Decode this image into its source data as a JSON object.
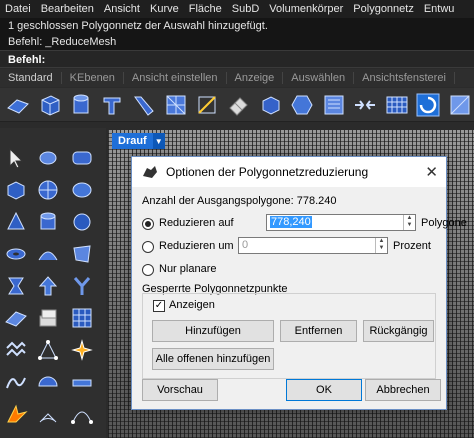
{
  "menu": [
    "Datei",
    "Bearbeiten",
    "Ansicht",
    "Kurve",
    "Fläche",
    "SubD",
    "Volumenkörper",
    "Polygonnetz",
    "Entwu"
  ],
  "command_history": [
    "1 geschlossen Polygonnetz der Auswahl hinzugefügt.",
    "Befehl: _ReduceMesh"
  ],
  "command_prompt": "Befehl:",
  "tabs": [
    "Standard",
    "KEbenen",
    "Ansicht einstellen",
    "Anzeige",
    "Auswählen",
    "Ansichtsfensterei"
  ],
  "viewport_label": "Drauf",
  "accent_color": "#1e6fd8",
  "dialog": {
    "title": "Optionen der Polygonnetzreduzierung",
    "source_count_label": "Anzahl der Ausgangspolygone:",
    "source_count_value": "778.240",
    "reduce_to_label": "Reduzieren auf",
    "reduce_to_value": "778,240",
    "reduce_to_unit": "Polygone",
    "reduce_by_label": "Reduzieren um",
    "reduce_by_value": "0",
    "reduce_by_unit": "Prozent",
    "planar_only_label": "Nur planare",
    "locked_group_label": "Gesperrte Polygonnetzpunkte",
    "show_label": "Anzeigen",
    "add_button": "Hinzufügen",
    "remove_button": "Entfernen",
    "undo_button": "Rückgängig",
    "add_all_open_button": "Alle offenen hinzufügen",
    "preview_button": "Vorschau",
    "ok_button": "OK",
    "cancel_button": "Abbrechen",
    "close_glyph": "✕"
  }
}
